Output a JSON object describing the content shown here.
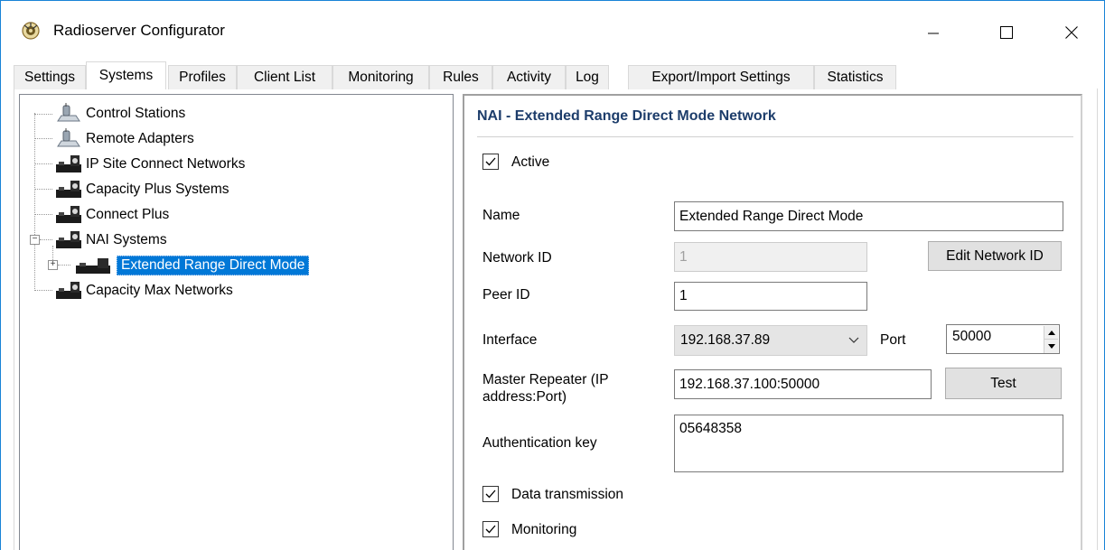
{
  "window": {
    "title": "Radioserver Configurator"
  },
  "tabs": [
    {
      "label": "Settings"
    },
    {
      "label": "Systems"
    },
    {
      "label": "Profiles"
    },
    {
      "label": "Client List"
    },
    {
      "label": "Monitoring"
    },
    {
      "label": "Rules"
    },
    {
      "label": "Activity"
    },
    {
      "label": "Log"
    },
    {
      "label": "Export/Import Settings"
    },
    {
      "label": "Statistics"
    }
  ],
  "tree": {
    "items": [
      {
        "label": "Control Stations",
        "icon": "control-station-icon"
      },
      {
        "label": "Remote Adapters",
        "icon": "remote-adapter-icon"
      },
      {
        "label": "IP Site Connect Networks",
        "icon": "network-icon"
      },
      {
        "label": "Capacity Plus Systems",
        "icon": "network-icon"
      },
      {
        "label": "Connect Plus",
        "icon": "network-icon"
      },
      {
        "label": "NAI Systems",
        "icon": "network-icon",
        "expanded": true
      },
      {
        "label": "Extended Range Direct Mode",
        "icon": "network-icon",
        "selected": true
      },
      {
        "label": "Capacity Max Networks",
        "icon": "network-icon"
      }
    ]
  },
  "panel": {
    "title": "NAI - Extended Range Direct Mode Network",
    "active_label": "Active",
    "name_label": "Name",
    "name_value": "Extended Range Direct Mode",
    "network_id_label": "Network ID",
    "network_id_value": "1",
    "edit_network_id_button": "Edit Network ID",
    "peer_id_label": "Peer ID",
    "peer_id_value": "1",
    "interface_label": "Interface",
    "interface_value": "192.168.37.89",
    "port_label": "Port",
    "port_value": "50000",
    "master_repeater_label_line1": "Master Repeater (IP",
    "master_repeater_label_line2": "address:Port)",
    "master_repeater_value": "192.168.37.100:50000",
    "test_button": "Test",
    "auth_key_label": "Authentication key",
    "auth_key_value": "05648358",
    "data_transmission_label": "Data transmission",
    "monitoring_label": "Monitoring"
  },
  "colors": {
    "accent": "#0078d7",
    "title_blue": "#1d3d6b",
    "window_border": "#1883d7"
  }
}
